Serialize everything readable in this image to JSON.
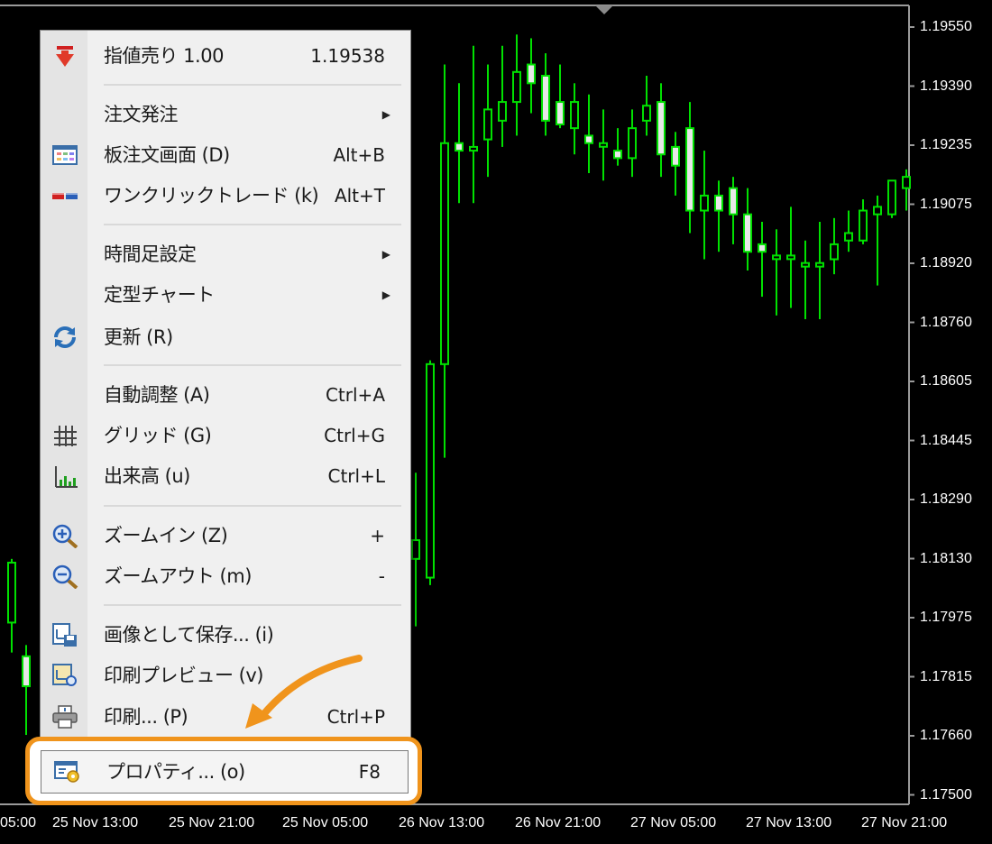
{
  "price_axis": [
    "1.19550",
    "1.19390",
    "1.19235",
    "1.19075",
    "1.18920",
    "1.18760",
    "1.18605",
    "1.18445",
    "1.18290",
    "1.18130",
    "1.17975",
    "1.17815",
    "1.17660",
    "1.17500"
  ],
  "time_axis": [
    "05:00",
    "25 Nov 13:00",
    "25 Nov 21:00",
    "25 Nov 05:00",
    "26 Nov 13:00",
    "26 Nov 21:00",
    "27 Nov 05:00",
    "27 Nov 13:00",
    "27 Nov 21:00"
  ],
  "colors": {
    "bull": "#00e000",
    "body": "#e8e8e8",
    "highlight": "#f0941c"
  },
  "menu": {
    "items": [
      {
        "label": "指値売り 1.00",
        "shortcut": "1.19538",
        "icon": "sell-arrow-icon"
      },
      {
        "label": "注文発注",
        "submenu": true
      },
      {
        "label": "板注文画面 (D)",
        "shortcut": "Alt+B",
        "icon": "order-book-icon"
      },
      {
        "label": "ワンクリックトレード (k)",
        "shortcut": "Alt+T",
        "icon": "one-click-trade-icon"
      },
      {
        "label": "時間足設定",
        "submenu": true
      },
      {
        "label": "定型チャート",
        "submenu": true
      },
      {
        "label": "更新 (R)",
        "icon": "refresh-icon"
      },
      {
        "label": "自動調整 (A)",
        "shortcut": "Ctrl+A"
      },
      {
        "label": "グリッド (G)",
        "shortcut": "Ctrl+G",
        "icon": "grid-icon"
      },
      {
        "label": "出来高 (u)",
        "shortcut": "Ctrl+L",
        "icon": "volume-icon"
      },
      {
        "label": "ズームイン (Z)",
        "shortcut": "+",
        "icon": "zoom-in-icon"
      },
      {
        "label": "ズームアウト (m)",
        "shortcut": "-",
        "icon": "zoom-out-icon"
      },
      {
        "label": "画像として保存... (i)",
        "icon": "save-image-icon"
      },
      {
        "label": "印刷プレビュー (v)",
        "icon": "print-preview-icon"
      },
      {
        "label": "印刷... (P)",
        "shortcut": "Ctrl+P",
        "icon": "print-icon"
      }
    ],
    "highlighted": {
      "label": "プロパティ... (o)",
      "shortcut": "F8",
      "icon": "properties-icon"
    }
  },
  "candles": [
    [
      1.1812,
      1.1813,
      1.1796,
      1.1788
    ],
    [
      1.1787,
      1.179,
      1.1783,
      1.1766
    ],
    [
      1.1818,
      1.1823,
      1.1813,
      1.1802
    ],
    [
      1.1834,
      1.1826,
      1.1799,
      1.178
    ],
    [
      1.1825,
      1.1833,
      1.1825,
      1.1802
    ],
    [
      1.181,
      1.1832,
      1.1788,
      1.178
    ],
    [
      1.1829,
      1.1825,
      1.179,
      1.1782
    ],
    [
      1.1812,
      1.1812,
      1.182,
      1.1818
    ],
    [
      1.1828,
      1.1813,
      1.1824,
      1.1812
    ],
    [
      1.1842,
      1.181,
      1.186,
      1.1822
    ],
    [
      1.1832,
      1.1833,
      1.1814,
      1.1802
    ],
    [
      1.182,
      1.1864,
      1.1823,
      1.181
    ],
    [
      1.1815,
      1.1828,
      1.1815,
      1.18
    ],
    [
      1.1828,
      1.1822,
      1.1822,
      1.179
    ],
    [
      1.1835,
      1.1813,
      1.183,
      1.181
    ],
    [
      1.1837,
      1.1817,
      1.1806,
      1.1796
    ],
    [
      1.1812,
      1.1816,
      1.1807,
      1.1793
    ],
    [
      1.1839,
      1.182,
      1.1813,
      1.1806
    ],
    [
      1.1855,
      1.1832,
      1.186,
      1.184
    ],
    [
      1.1865,
      1.186,
      1.184,
      1.182
    ],
    [
      1.188,
      1.181,
      1.181,
      1.1793
    ],
    [
      1.1867,
      1.1812,
      1.1813,
      1.1802
    ],
    [
      1.1815,
      1.1815,
      1.1811,
      1.1808
    ],
    [
      1.1838,
      1.1829,
      1.1831,
      1.1825
    ],
    [
      1.1808,
      1.1812,
      1.1809,
      1.1803
    ],
    [
      1.1815,
      1.1831,
      1.1847,
      1.1806
    ],
    [
      1.182,
      1.1814,
      1.1809,
      1.18
    ],
    [
      1.1825,
      1.1829,
      1.1806,
      1.1804
    ],
    [
      1.1887,
      1.1887,
      1.183,
      1.1805
    ],
    [
      1.1882,
      1.1863,
      1.1864,
      1.1855
    ],
    [
      1.19,
      1.1915,
      1.1914,
      1.1899
    ],
    [
      1.1895,
      1.1895,
      1.1877,
      1.187
    ],
    [
      1.1845,
      1.1848,
      1.1845,
      1.1835
    ],
    [
      1.185,
      1.1836,
      1.1837,
      1.1825
    ],
    [
      1.1827,
      1.1825,
      1.1845,
      1.183
    ],
    [
      1.1822,
      1.184,
      1.1817,
      1.1805
    ]
  ]
}
